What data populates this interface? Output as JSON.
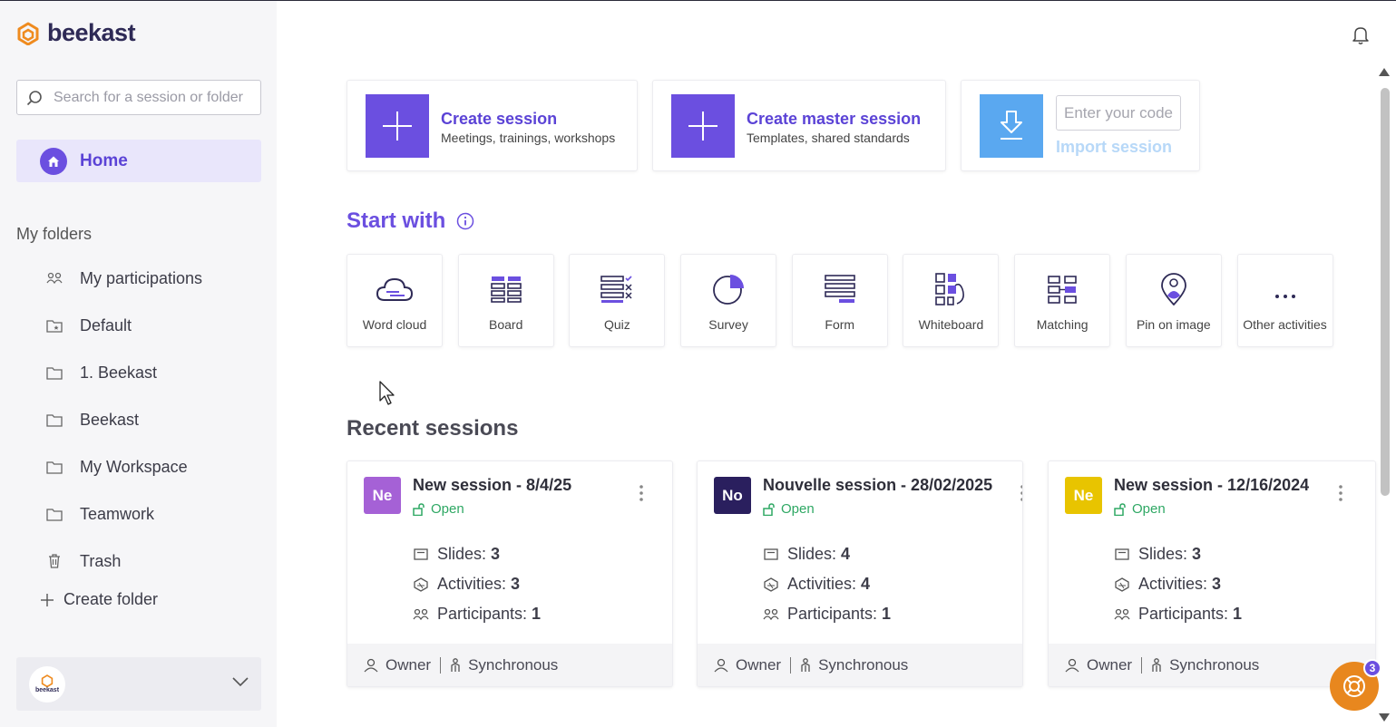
{
  "app": {
    "name": "beekast"
  },
  "search": {
    "placeholder": "Search for a session or folder"
  },
  "nav": {
    "home_label": "Home"
  },
  "folders": {
    "title": "My folders",
    "items": [
      {
        "label": "My participations",
        "icon": "participants-icon"
      },
      {
        "label": "Default",
        "icon": "folder-star-icon"
      },
      {
        "label": "1. Beekast",
        "icon": "folder-icon"
      },
      {
        "label": "Beekast",
        "icon": "folder-icon"
      },
      {
        "label": "My Workspace",
        "icon": "folder-icon"
      },
      {
        "label": "Teamwork",
        "icon": "folder-icon"
      },
      {
        "label": "Trash",
        "icon": "trash-icon"
      }
    ],
    "create_label": "Create folder"
  },
  "org": {
    "logo_text": "beekast"
  },
  "actions": {
    "create_session": {
      "title": "Create session",
      "subtitle": "Meetings, trainings, workshops"
    },
    "create_master": {
      "title": "Create master session",
      "subtitle": "Templates, shared standards"
    },
    "import": {
      "placeholder": "Enter your code",
      "label": "Import session"
    }
  },
  "start_with": {
    "title": "Start with",
    "activities": [
      {
        "label": "Word cloud",
        "icon": "cloud-icon"
      },
      {
        "label": "Board",
        "icon": "board-icon"
      },
      {
        "label": "Quiz",
        "icon": "quiz-icon"
      },
      {
        "label": "Survey",
        "icon": "pie-icon"
      },
      {
        "label": "Form",
        "icon": "form-icon"
      },
      {
        "label": "Whiteboard",
        "icon": "whiteboard-icon"
      },
      {
        "label": "Matching",
        "icon": "matching-icon"
      },
      {
        "label": "Pin on image",
        "icon": "pin-icon"
      },
      {
        "label": "Other activities",
        "icon": "more-icon"
      }
    ]
  },
  "recent": {
    "title": "Recent sessions",
    "sessions": [
      {
        "initials": "Ne",
        "color": "#a561d6",
        "title": "New session - 8/4/25",
        "status": "Open",
        "slides_label": "Slides:",
        "slides": "3",
        "activities_label": "Activities:",
        "activities": "3",
        "participants_label": "Participants:",
        "participants": "1",
        "role": "Owner",
        "mode": "Synchronous"
      },
      {
        "initials": "No",
        "color": "#2a1f5e",
        "title": "Nouvelle session - 28/02/2025",
        "status": "Open",
        "slides_label": "Slides:",
        "slides": "4",
        "activities_label": "Activities:",
        "activities": "4",
        "participants_label": "Participants:",
        "participants": "1",
        "role": "Owner",
        "mode": "Synchronous"
      },
      {
        "initials": "Ne",
        "color": "#e8c400",
        "title": "New session - 12/16/2024",
        "status": "Open",
        "slides_label": "Slides:",
        "slides": "3",
        "activities_label": "Activities:",
        "activities": "3",
        "participants_label": "Participants:",
        "participants": "1",
        "role": "Owner",
        "mode": "Synchronous"
      }
    ]
  },
  "help": {
    "badge": "3"
  },
  "colors": {
    "brand": "#6b4fe0",
    "accent": "#e8871e",
    "open": "#2fa864",
    "import": "#5aa8f0"
  }
}
